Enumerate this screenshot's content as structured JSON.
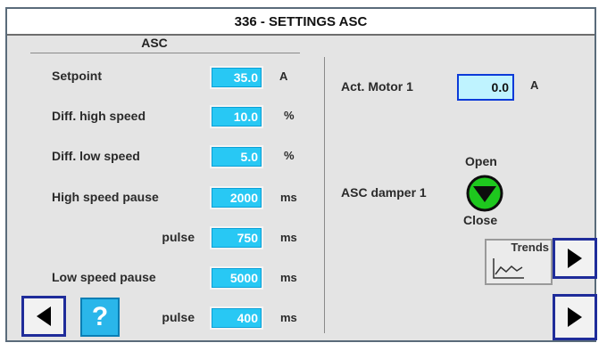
{
  "window": {
    "title": "336 - SETTINGS ASC"
  },
  "section": {
    "label": "ASC"
  },
  "settings": [
    {
      "label": "Setpoint",
      "value": "35.0",
      "unit": "A"
    },
    {
      "label": "Diff. high speed",
      "value": "10.0",
      "unit": "%"
    },
    {
      "label": "Diff. low speed",
      "value": "5.0",
      "unit": "%"
    },
    {
      "label": "High speed pause",
      "value": "2000",
      "unit": "ms"
    },
    {
      "label": "pulse",
      "value": "750",
      "unit": "ms"
    },
    {
      "label": "Low speed pause",
      "value": "5000",
      "unit": "ms"
    },
    {
      "label": "pulse",
      "value": "400",
      "unit": "ms"
    }
  ],
  "motor": {
    "label": "Act. Motor 1",
    "value": "0.0",
    "unit": "A"
  },
  "damper": {
    "label": "ASC damper 1",
    "open_label": "Open",
    "close_label": "Close",
    "state_color": "#1ec81e"
  },
  "trends": {
    "label": "Trends"
  },
  "help": {
    "label": "?"
  },
  "colors": {
    "field": "#28c8f4",
    "nav_border": "#1f2c9a"
  },
  "icons": {
    "prev": "triangle-left-icon",
    "next": "triangle-right-icon",
    "trend": "trend-chart-icon",
    "damper": "down-arrow-circle-icon"
  }
}
